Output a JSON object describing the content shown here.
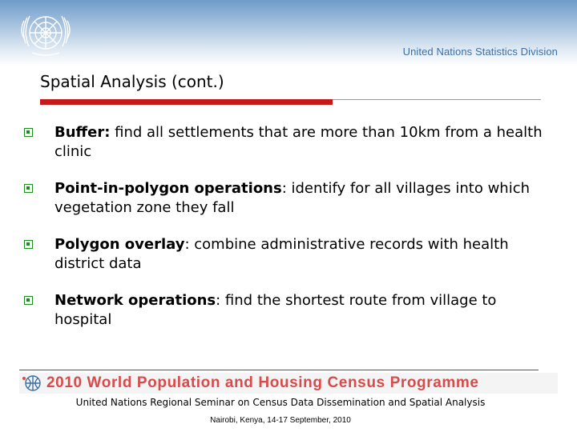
{
  "header": {
    "division": "United Nations Statistics Division"
  },
  "slide": {
    "title": "Spatial Analysis (cont.)",
    "bullets": [
      {
        "term": "Buffer:",
        "rest": " find all settlements that are more than 10km from a health clinic"
      },
      {
        "term": "Point-in-polygon operations",
        "rest": ": identify for all villages into which vegetation zone they fall"
      },
      {
        "term": "Polygon overlay",
        "rest": ": combine administrative records with health district data"
      },
      {
        "term": "Network operations",
        "rest": ": find the shortest route from village to hospital"
      }
    ]
  },
  "footer": {
    "programme": "2010 World Population and Housing Census Programme",
    "seminar": "United Nations Regional Seminar on Census Data Dissemination and Spatial Analysis",
    "location": "Nairobi, Kenya, 14-17 September, 2010"
  },
  "colors": {
    "accent_red": "#c41a1a",
    "bullet_green": "#1f8a1f",
    "un_blue": "#3c6fa6"
  }
}
